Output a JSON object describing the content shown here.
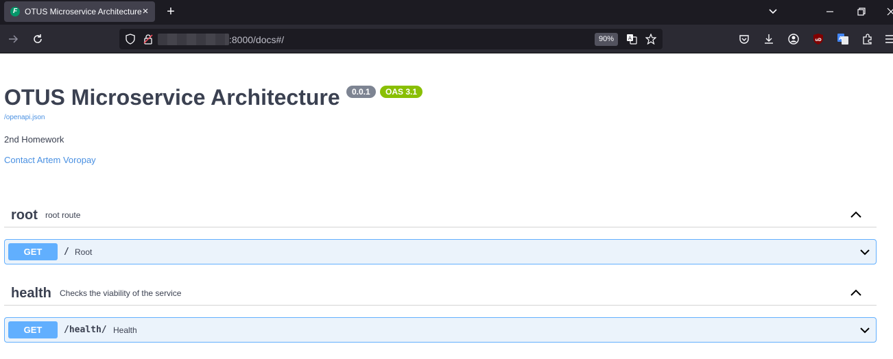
{
  "browser": {
    "tab": {
      "title": "OTUS Microservice Architecture",
      "favicon": "fastapi-favicon",
      "favicon_glyph": "F"
    },
    "url": {
      "visible": ":8000/docs#/",
      "zoom": "90%"
    },
    "toolbar_icons": [
      "back-arrow-icon",
      "reload-icon",
      "shield-icon",
      "lock-icon",
      "translate-icon",
      "star-icon",
      "pocket-icon",
      "download-icon",
      "account-icon",
      "ublock-icon",
      "translate-extension-icon",
      "extensions-icon",
      "menu-icon"
    ]
  },
  "info": {
    "title": "OTUS Microservice Architecture",
    "version": "0.0.1",
    "oas": "OAS 3.1",
    "openapi_link": "/openapi.json",
    "description": "2nd Homework",
    "contact": "Contact Artem Voropay"
  },
  "tags": [
    {
      "name": "root",
      "description": "root route",
      "operations": [
        {
          "method": "GET",
          "path": "/",
          "summary": "Root"
        }
      ]
    },
    {
      "name": "health",
      "description": "Checks the viability of the service",
      "operations": [
        {
          "method": "GET",
          "path": "/health/",
          "summary": "Health"
        }
      ]
    }
  ],
  "colors": {
    "get": "#61affe",
    "get_bg": "#ebf3fb",
    "version_badge": "#7d8492",
    "oas_badge": "#89bf04",
    "link": "#4990e2"
  }
}
